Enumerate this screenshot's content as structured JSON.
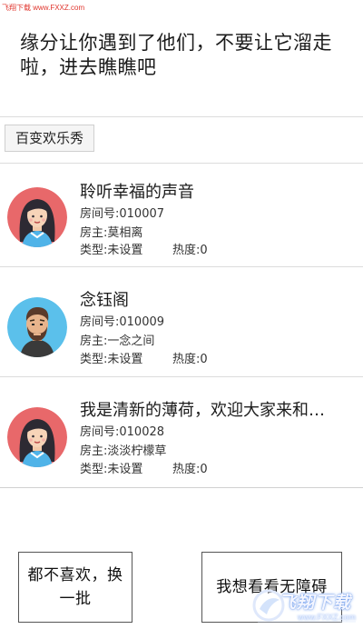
{
  "watermark": {
    "top_text": "飞翔下载 www.FXXZ.com",
    "brand": "飞翔下载",
    "url": "www.FXXZ.com"
  },
  "headline": "缘分让你遇到了他们，不要让它溜走啦，进去瞧瞧吧",
  "category": {
    "label": "百变欢乐秀"
  },
  "rooms": [
    {
      "title": "聆听幸福的声音",
      "room_no": "房间号:010007",
      "owner": "房主:莫相离",
      "type": "类型:未设置",
      "heat": "热度:0",
      "avatar": "female-avatar-icon"
    },
    {
      "title": "念钰阁",
      "room_no": "房间号:010009",
      "owner": "房主:一念之间",
      "type": "类型:未设置",
      "heat": "热度:0",
      "avatar": "male-avatar-icon"
    },
    {
      "title": "我是清新的薄荷，欢迎大家来和…",
      "room_no": "房间号:010028",
      "owner": "房主:淡淡柠檬草",
      "type": "类型:未设置",
      "heat": "热度:0",
      "avatar": "female-avatar-icon"
    }
  ],
  "buttons": {
    "refresh": "都不喜欢，换一批",
    "accessible": "我想看看无障碍"
  },
  "colors": {
    "watermark_red": "#e0342c",
    "female_avatar_bg": "#e8686a",
    "male_avatar_bg": "#5bc0eb"
  }
}
